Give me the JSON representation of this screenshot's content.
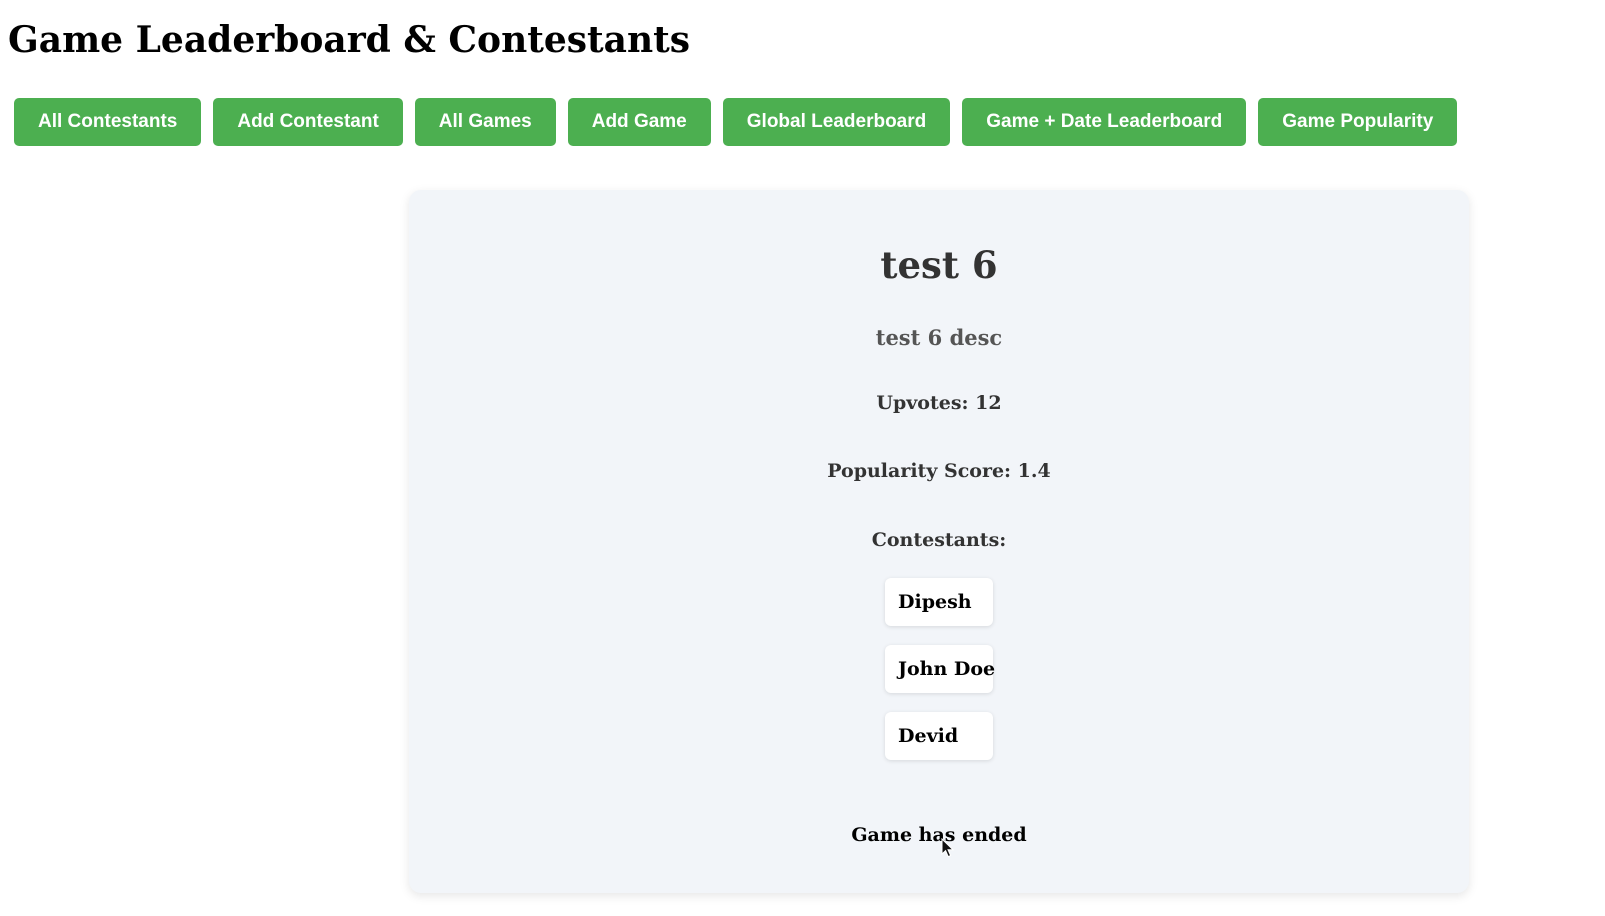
{
  "page": {
    "title": "Game Leaderboard & Contestants"
  },
  "nav": {
    "buttons": [
      {
        "label": "All Contestants"
      },
      {
        "label": "Add Contestant"
      },
      {
        "label": "All Games"
      },
      {
        "label": "Add Game"
      },
      {
        "label": "Global Leaderboard"
      },
      {
        "label": "Game + Date Leaderboard"
      },
      {
        "label": "Game Popularity"
      }
    ]
  },
  "game": {
    "name": "test 6",
    "description": "test 6 desc",
    "upvotes_text": "Upvotes: 12",
    "popularity_text": "Popularity Score: 1.4",
    "contestants_label": "Contestants:",
    "contestants": [
      {
        "name": "Dipesh"
      },
      {
        "name": "John Doe"
      },
      {
        "name": "Devid"
      }
    ],
    "status": "Game has ended"
  },
  "colors": {
    "accent": "#4caf50",
    "card_background": "#f2f5f9",
    "heading": "#333333",
    "description": "#555555"
  },
  "icons": {
    "cursor": "mouse-pointer-icon"
  }
}
